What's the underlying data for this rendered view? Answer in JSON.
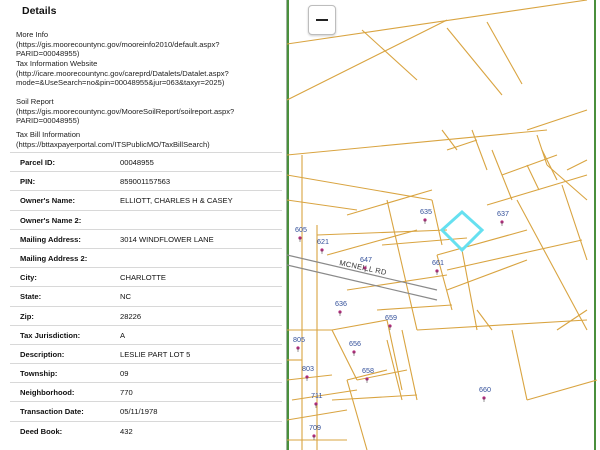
{
  "panel": {
    "title": "Details",
    "links": [
      {
        "label": "More Info",
        "url_lines": [
          "(https://gis.moorecountync.gov/mooreinfo2010/default.aspx?",
          "PARID=00048955)"
        ]
      },
      {
        "label": "Tax Information Website",
        "url_lines": [
          "(http://icare.moorecountync.gov/careprd/Datalets/Datalet.aspx?",
          "mode=&UseSearch=no&pin=00048955&jur=063&taxyr=2025)"
        ]
      },
      {
        "label": "Soil Report",
        "url_lines": [
          "(https://gis.moorecountync.gov/MooreSoilReport/soilreport.aspx?",
          "PARID=00048955)"
        ]
      },
      {
        "label": "Tax Bill Information",
        "url_lines": [
          "(https://bttaxpayerportal.com/ITSPublicMO/TaxBillSearch)"
        ]
      }
    ],
    "rows": [
      {
        "label": "Parcel ID:",
        "value": "00048955"
      },
      {
        "label": "PIN:",
        "value": "859001157563"
      },
      {
        "label": "Owner's Name:",
        "value": "ELLIOTT, CHARLES H & CASEY"
      },
      {
        "label": "Owner's Name 2:",
        "value": ""
      },
      {
        "label": "Mailing Address:",
        "value": "3014 WINDFLOWER LANE"
      },
      {
        "label": "Mailing Address 2:",
        "value": ""
      },
      {
        "label": "City:",
        "value": "CHARLOTTE"
      },
      {
        "label": "State:",
        "value": "NC"
      },
      {
        "label": "Zip:",
        "value": "28226"
      },
      {
        "label": "Tax Jurisdiction:",
        "value": "A"
      },
      {
        "label": "Description:",
        "value": "LESLIE PART LOT 5"
      },
      {
        "label": "Township:",
        "value": "09"
      },
      {
        "label": "Neighborhood:",
        "value": "770"
      },
      {
        "label": "Transaction Date:",
        "value": "05/11/1978"
      },
      {
        "label": "Deed Book:",
        "value": "432"
      }
    ]
  },
  "map": {
    "zoom_out_icon": "minus-icon",
    "road_name": "MCNEILL RD",
    "parcel_labels": [
      "605",
      "621",
      "635",
      "637",
      "647",
      "661",
      "636",
      "659",
      "656",
      "805",
      "803",
      "658",
      "711",
      "660",
      "709"
    ],
    "colors": {
      "parcel_line": "#d9a441",
      "selected_parcel": "#66e0f0",
      "label": "#33509a",
      "pin": "#b0297a",
      "map_border": "#4a8f3c"
    }
  }
}
